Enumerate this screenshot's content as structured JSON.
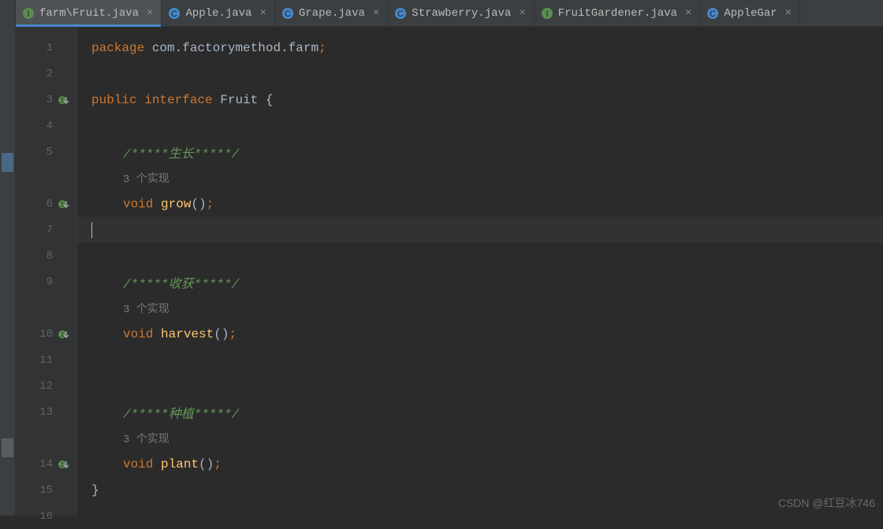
{
  "tabs": [
    {
      "label": "farm\\Fruit.java",
      "icon": "interface",
      "active": true
    },
    {
      "label": "Apple.java",
      "icon": "class",
      "active": false
    },
    {
      "label": "Grape.java",
      "icon": "class",
      "active": false
    },
    {
      "label": "Strawberry.java",
      "icon": "class",
      "active": false
    },
    {
      "label": "FruitGardener.java",
      "icon": "interface",
      "active": false
    },
    {
      "label": "AppleGar",
      "icon": "class",
      "active": false
    }
  ],
  "gutter": [
    {
      "ln": "1",
      "icon": null
    },
    {
      "ln": "2",
      "icon": null
    },
    {
      "ln": "3",
      "icon": "implemented"
    },
    {
      "ln": "4",
      "icon": null
    },
    {
      "ln": "5",
      "icon": null
    },
    {
      "ln": "",
      "icon": null
    },
    {
      "ln": "6",
      "icon": "implemented"
    },
    {
      "ln": "7",
      "icon": null
    },
    {
      "ln": "8",
      "icon": null
    },
    {
      "ln": "9",
      "icon": null
    },
    {
      "ln": "",
      "icon": null
    },
    {
      "ln": "10",
      "icon": "implemented"
    },
    {
      "ln": "11",
      "icon": null
    },
    {
      "ln": "12",
      "icon": null
    },
    {
      "ln": "13",
      "icon": null
    },
    {
      "ln": "",
      "icon": null
    },
    {
      "ln": "14",
      "icon": "implemented"
    },
    {
      "ln": "15",
      "icon": null
    },
    {
      "ln": "16",
      "icon": null
    }
  ],
  "code": {
    "pkg_kw": "package",
    "pkg_name": " com.factorymethod.farm",
    "semicolon": ";",
    "public_kw": "public",
    "interface_kw": "interface",
    "iname": "Fruit",
    "lbrace": "{",
    "rbrace": "}",
    "void_kw": "void",
    "lparen": "(",
    "rparen": ")",
    "cmt_grow": "/*****生长*****/",
    "cmt_harvest": "/*****收获*****/",
    "cmt_plant": "/*****种植*****/",
    "inlay": "3 个实现",
    "grow": "grow",
    "harvest": "harvest",
    "plant": "plant"
  },
  "watermark": "CSDN @红豆冰746"
}
